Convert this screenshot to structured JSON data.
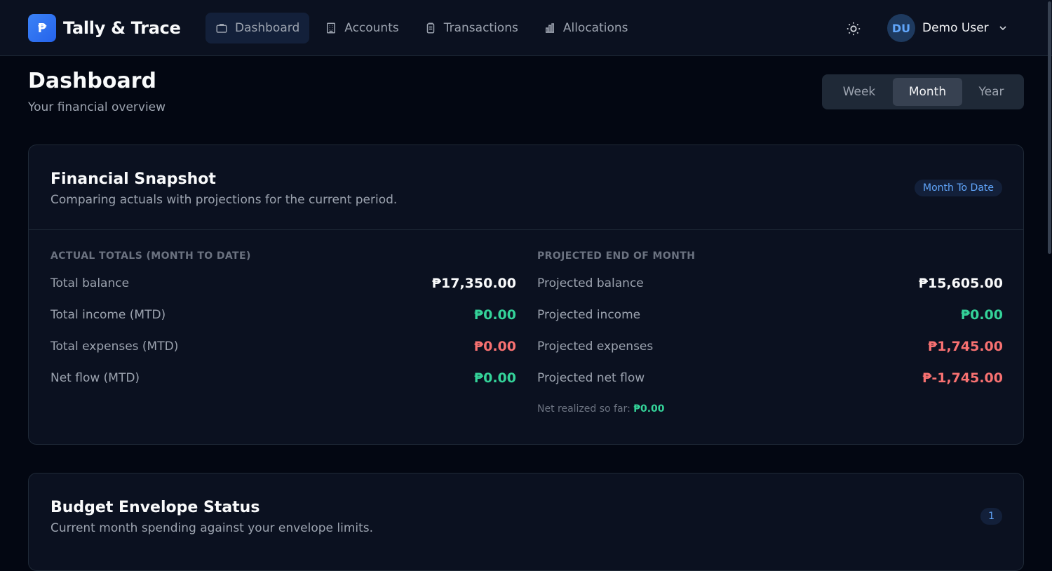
{
  "brand": {
    "logo_glyph": "₱",
    "name": "Tally & Trace",
    "accent": "#3b82f6"
  },
  "nav": {
    "items": [
      {
        "label": "Dashboard",
        "icon": "briefcase-icon",
        "active": true
      },
      {
        "label": "Accounts",
        "icon": "building-icon",
        "active": false
      },
      {
        "label": "Transactions",
        "icon": "clipboard-icon",
        "active": false
      },
      {
        "label": "Allocations",
        "icon": "bar-chart-icon",
        "active": false
      }
    ]
  },
  "header_actions": {
    "theme_icon": "sun-icon"
  },
  "user": {
    "initials": "DU",
    "name": "Demo User"
  },
  "page": {
    "title": "Dashboard",
    "subtitle": "Your financial overview"
  },
  "period": {
    "options": [
      "Week",
      "Month",
      "Year"
    ],
    "selected": "Month"
  },
  "snapshot": {
    "title": "Financial Snapshot",
    "subtitle": "Comparing actuals with projections for the current period.",
    "badge": "Month To Date",
    "actual": {
      "heading": "ACTUAL TOTALS (MONTH TO DATE)",
      "rows": [
        {
          "label": "Total balance",
          "value": "₱17,350.00",
          "tone": "white"
        },
        {
          "label": "Total income (MTD)",
          "value": "₱0.00",
          "tone": "green"
        },
        {
          "label": "Total expenses (MTD)",
          "value": "₱0.00",
          "tone": "red"
        },
        {
          "label": "Net flow (MTD)",
          "value": "₱0.00",
          "tone": "green"
        }
      ]
    },
    "projected": {
      "heading": "PROJECTED END OF MONTH",
      "rows": [
        {
          "label": "Projected balance",
          "value": "₱15,605.00",
          "tone": "white"
        },
        {
          "label": "Projected income",
          "value": "₱0.00",
          "tone": "green"
        },
        {
          "label": "Projected expenses",
          "value": "₱1,745.00",
          "tone": "red"
        },
        {
          "label": "Projected net flow",
          "value": "₱-1,745.00",
          "tone": "red"
        }
      ],
      "note_label": "Net realized so far:",
      "note_value": "₱0.00"
    }
  },
  "budget": {
    "title": "Budget Envelope Status",
    "subtitle": "Current month spending against your envelope limits.",
    "count": "1"
  },
  "colors": {
    "positive": "#34d399",
    "negative": "#f87171",
    "background": "#030712"
  }
}
